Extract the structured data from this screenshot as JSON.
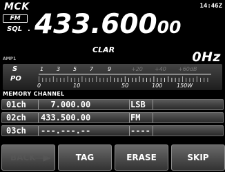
{
  "status": {
    "vfo": "MCK",
    "time": "14:46Z",
    "mode": "FM",
    "sql": "SQL",
    "sql_dot": "."
  },
  "frequency": {
    "main": "433.600",
    "fine": "00"
  },
  "clar": {
    "label": "CLAR",
    "offset": "0Hz"
  },
  "amp_label": "AMP1",
  "meter": {
    "s_label": "S",
    "po_label": "PO",
    "s_scale": [
      "1",
      "3",
      "5",
      "7",
      "9",
      "+20",
      "+40",
      "+60dB"
    ],
    "po_scale": [
      "0",
      "10",
      "50",
      "100",
      "150W"
    ],
    "colors": {
      "active": "#ffffff",
      "inactive": "#777777"
    }
  },
  "memory": {
    "title": "MEMORY CHANNEL",
    "rows": [
      {
        "ch": "01ch",
        "freq": "  7.000.00",
        "mode": "LSB"
      },
      {
        "ch": "02ch",
        "freq": "433.500.00",
        "mode": "FM"
      },
      {
        "ch": "03ch",
        "freq": "---.---.--",
        "mode": "----"
      }
    ]
  },
  "buttons": {
    "back": "BACK",
    "tag": "TAG",
    "erase": "ERASE",
    "skip": "SKIP"
  }
}
